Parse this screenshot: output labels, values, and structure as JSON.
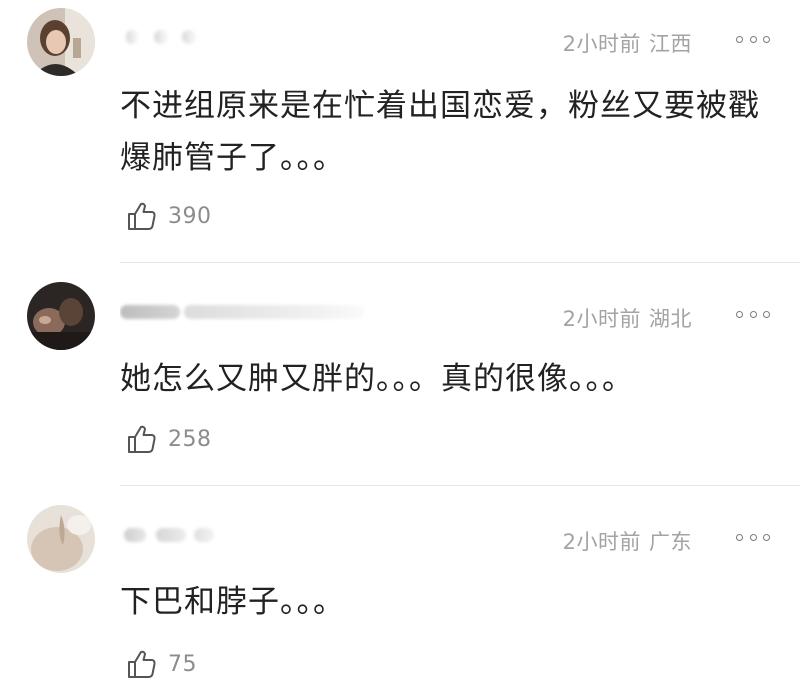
{
  "comments": [
    {
      "time": "2小时前",
      "location": "江西",
      "text": "不进组原来是在忙着出国恋爱，粉丝又要被戳爆肺管子了。。。",
      "likes": "390",
      "avatar": "avatar-icon"
    },
    {
      "time": "2小时前",
      "location": "湖北",
      "text": "她怎么又肿又胖的。。。真的很像。。。",
      "likes": "258",
      "avatar": "avatar-icon"
    },
    {
      "time": "2小时前",
      "location": "广东",
      "text": "下巴和脖子。。。",
      "likes": "75",
      "avatar": "avatar-icon"
    }
  ],
  "icons": {
    "like": "thumbs-up-icon",
    "more": "more-options-icon"
  },
  "colors": {
    "meta_text": "#a3a3a3",
    "body_text": "#222222",
    "like_count": "#8c8c8c",
    "divider": "#e6e6e6"
  }
}
